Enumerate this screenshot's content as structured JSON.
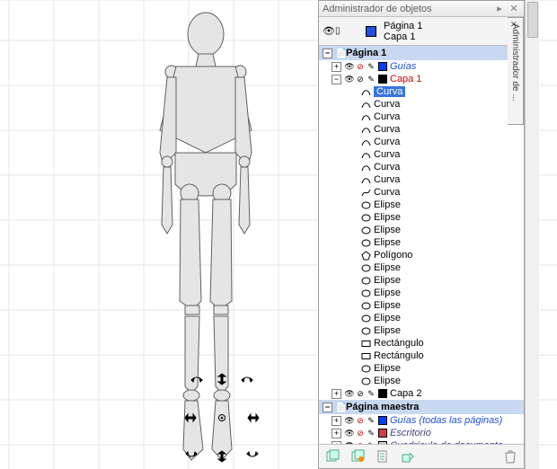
{
  "panel": {
    "title": "Administrador de objetos",
    "dock_tab": "Administrador de ...",
    "header": {
      "page": "Página 1",
      "layer": "Capa 1"
    },
    "pages": [
      {
        "kind": "page",
        "label": "Página 1",
        "expanded": true
      },
      {
        "kind": "layer",
        "label": "Guías",
        "color": "blue",
        "italic": true,
        "indent": 1,
        "locked": true
      },
      {
        "kind": "layer",
        "label": "Capa 1",
        "color": "black",
        "active": true,
        "indent": 1,
        "expanded": true
      },
      {
        "kind": "obj",
        "icon": "curve",
        "label": "Curva",
        "indent": 2,
        "selected": true
      },
      {
        "kind": "obj",
        "icon": "curve",
        "label": "Curva",
        "indent": 2
      },
      {
        "kind": "obj",
        "icon": "curve",
        "label": "Curva",
        "indent": 2
      },
      {
        "kind": "obj",
        "icon": "curve",
        "label": "Curva",
        "indent": 2
      },
      {
        "kind": "obj",
        "icon": "curve",
        "label": "Curva",
        "indent": 2
      },
      {
        "kind": "obj",
        "icon": "curve",
        "label": "Curva",
        "indent": 2
      },
      {
        "kind": "obj",
        "icon": "curve",
        "label": "Curva",
        "indent": 2
      },
      {
        "kind": "obj",
        "icon": "curve",
        "label": "Curva",
        "indent": 2
      },
      {
        "kind": "obj",
        "icon": "curve-open",
        "label": "Curva",
        "indent": 2
      },
      {
        "kind": "obj",
        "icon": "ellipse",
        "label": "Elipse",
        "indent": 2
      },
      {
        "kind": "obj",
        "icon": "ellipse",
        "label": "Elipse",
        "indent": 2
      },
      {
        "kind": "obj",
        "icon": "ellipse",
        "label": "Elipse",
        "indent": 2
      },
      {
        "kind": "obj",
        "icon": "ellipse",
        "label": "Elipse",
        "indent": 2
      },
      {
        "kind": "obj",
        "icon": "polygon",
        "label": "Polígono",
        "indent": 2
      },
      {
        "kind": "obj",
        "icon": "ellipse",
        "label": "Elipse",
        "indent": 2
      },
      {
        "kind": "obj",
        "icon": "ellipse",
        "label": "Elipse",
        "indent": 2
      },
      {
        "kind": "obj",
        "icon": "ellipse",
        "label": "Elipse",
        "indent": 2
      },
      {
        "kind": "obj",
        "icon": "ellipse",
        "label": "Elipse",
        "indent": 2
      },
      {
        "kind": "obj",
        "icon": "ellipse",
        "label": "Elipse",
        "indent": 2
      },
      {
        "kind": "obj",
        "icon": "ellipse",
        "label": "Elipse",
        "indent": 2
      },
      {
        "kind": "obj",
        "icon": "rect",
        "label": "Rectángulo",
        "indent": 2
      },
      {
        "kind": "obj",
        "icon": "rect",
        "label": "Rectángulo",
        "indent": 2
      },
      {
        "kind": "obj",
        "icon": "ellipse",
        "label": "Elipse",
        "indent": 2
      },
      {
        "kind": "obj",
        "icon": "ellipse",
        "label": "Elipse",
        "indent": 2
      },
      {
        "kind": "layer",
        "label": "Capa 2",
        "color": "black",
        "indent": 1,
        "neutral": true
      },
      {
        "kind": "master",
        "label": "Página maestra",
        "expanded": true
      },
      {
        "kind": "layer",
        "label": "Guías (todas las páginas)",
        "color": "blue",
        "italic": true,
        "indent": 1,
        "locked": true
      },
      {
        "kind": "layer",
        "label": "Escritorio",
        "color": "red",
        "italic2": true,
        "indent": 1,
        "locked": true
      },
      {
        "kind": "layer",
        "label": "Cuadrícula de documento",
        "color": "grid",
        "italic2": true,
        "indent": 1,
        "locked": true
      }
    ]
  }
}
